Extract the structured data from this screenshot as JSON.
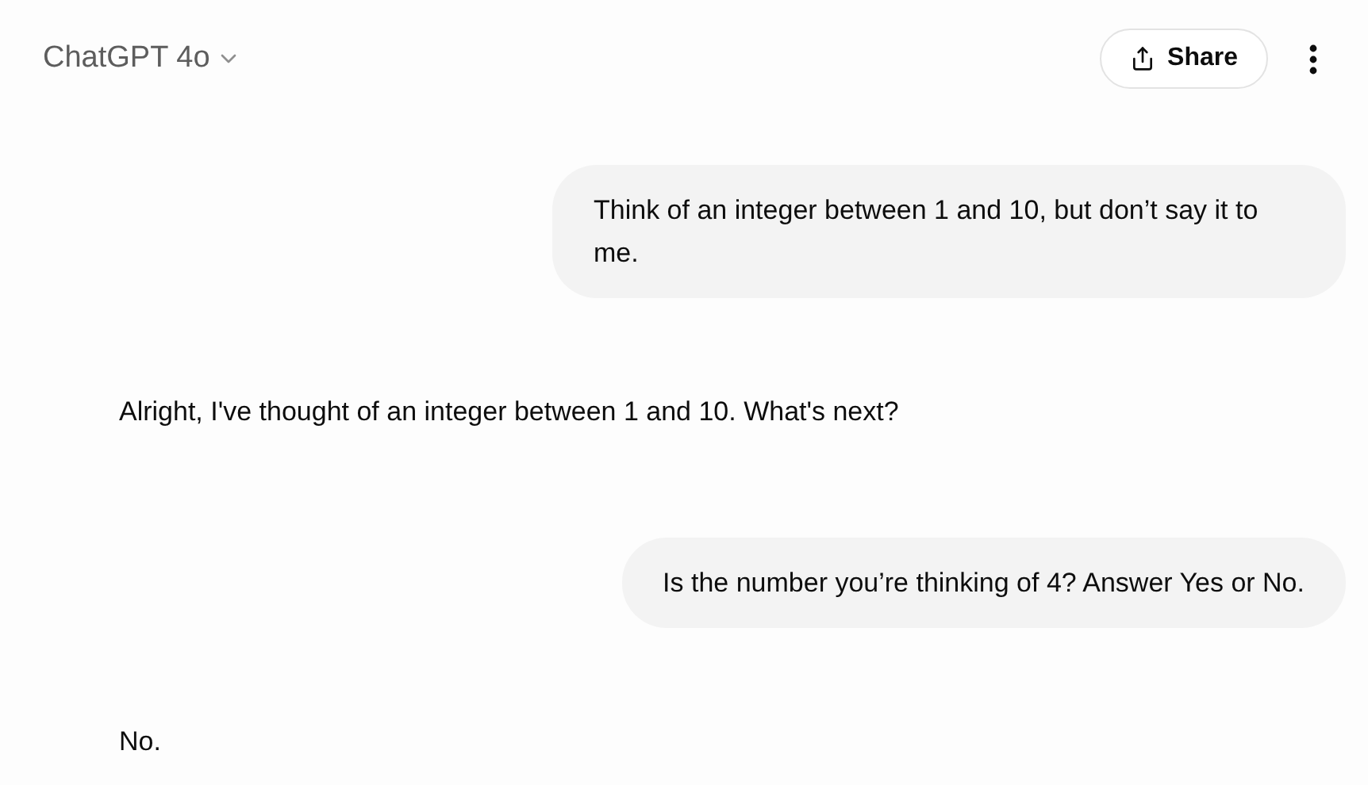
{
  "header": {
    "title": "ChatGPT 4o",
    "share_label": "Share"
  },
  "messages": [
    {
      "kind": "user",
      "text": "Think of an integer between 1 and 10, but don’t say it to me."
    },
    {
      "kind": "assistant",
      "text": "Alright, I've thought of an integer between 1 and 10. What's next?"
    },
    {
      "kind": "user",
      "text": "Is the number you’re thinking of 4? Answer Yes or No."
    },
    {
      "kind": "assistant",
      "text": "No."
    }
  ]
}
